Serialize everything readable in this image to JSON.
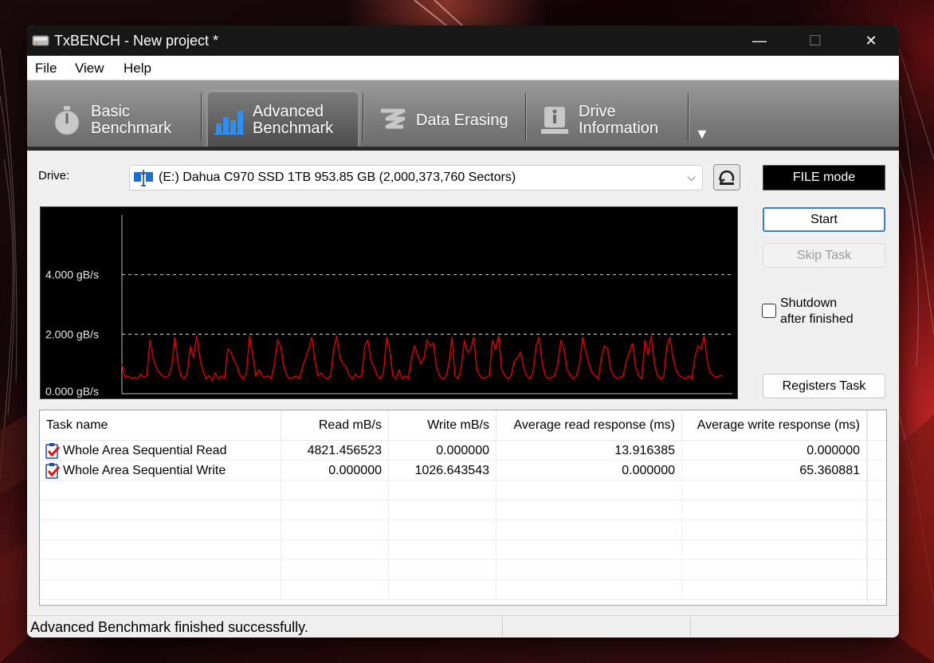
{
  "window": {
    "title": "TxBENCH - New project *",
    "minimize_glyph": "—",
    "maximize_glyph": "☐",
    "close_glyph": "✕"
  },
  "menu": {
    "items": [
      "File",
      "View",
      "Help"
    ]
  },
  "toolbar": {
    "tabs": [
      {
        "line1": "Basic",
        "line2": "Benchmark",
        "icon": "stopwatch-icon"
      },
      {
        "line1": "Advanced",
        "line2": "Benchmark",
        "icon": "bar-chart-icon",
        "active": true
      },
      {
        "line1": "Data Erasing",
        "line2": "",
        "icon": "eraser-icon"
      },
      {
        "line1": "Drive",
        "line2": "Information",
        "icon": "drive-info-icon"
      }
    ],
    "more_glyph": "▼"
  },
  "drive": {
    "label": "Drive:",
    "selected": "(E:) Dahua C970 SSD 1TB  953.85 GB (2,000,373,760 Sectors)",
    "chevron": "⌵",
    "mode": "FILE mode"
  },
  "buttons": {
    "start": "Start",
    "skip": "Skip Task",
    "shutdown_line1": "Shutdown",
    "shutdown_line2": "after finished",
    "registers": "Registers Task"
  },
  "chart_data": {
    "type": "line",
    "ylabel_ticks": [
      "4.000 gB/s",
      "2.000 gB/s",
      "0.000 gB/s"
    ],
    "ylim": [
      0,
      6.0
    ],
    "gridlines": [
      2.0,
      4.0
    ],
    "background": "#000000",
    "line_color": "#e00000",
    "series": [
      {
        "values": [
          1.0,
          0.55,
          0.6,
          0.5,
          0.55,
          0.5,
          0.65,
          0.55,
          0.6,
          1.8,
          1.2,
          0.9,
          0.7,
          0.6,
          0.55,
          0.6,
          0.9,
          1.9,
          1.0,
          0.6,
          0.5,
          0.7,
          1.6,
          1.2,
          1.95,
          1.2,
          0.8,
          0.5,
          0.6,
          0.45,
          0.7,
          0.5,
          0.6,
          0.5,
          1.5,
          1.4,
          1.1,
          0.9,
          0.6,
          0.5,
          0.7,
          1.95,
          1.3,
          0.6,
          0.8,
          0.6,
          0.55,
          0.6,
          0.5,
          1.0,
          1.8,
          1.6,
          0.9,
          0.6,
          0.5,
          0.55,
          0.6,
          0.5,
          0.9,
          1.2,
          1.5,
          1.9,
          1.1,
          0.6,
          0.7,
          0.55,
          0.5,
          0.6,
          1.5,
          1.95,
          1.2,
          1.0,
          0.9,
          0.6,
          0.5,
          0.65,
          0.55,
          0.6,
          1.6,
          1.8,
          1.1,
          0.9,
          0.6,
          0.5,
          0.7,
          1.9,
          1.5,
          0.6,
          0.5,
          0.8,
          0.5,
          0.6,
          0.5,
          1.2,
          1.6,
          1.3,
          1.0,
          1.2,
          1.8,
          1.6,
          1.7,
          0.9,
          0.6,
          0.5,
          0.55,
          1.0,
          1.9,
          0.6,
          0.5,
          0.9,
          1.8,
          1.4,
          1.5,
          1.9,
          0.8,
          0.6,
          0.5,
          0.55,
          0.6,
          1.8,
          1.5,
          1.95,
          0.8,
          0.6,
          0.5,
          0.6,
          1.1,
          1.2,
          1.4,
          0.9,
          0.6,
          0.5,
          0.7,
          1.6,
          1.9,
          1.0,
          0.6,
          0.5,
          0.55,
          0.6,
          1.0,
          1.8,
          1.5,
          0.8,
          0.6,
          0.5,
          0.6,
          1.0,
          1.9,
          1.4,
          1.0,
          0.7,
          0.6,
          0.5,
          1.2,
          1.6,
          1.5,
          0.8,
          0.6,
          0.5,
          0.55,
          0.6,
          1.1,
          1.4,
          1.7,
          0.9,
          0.6,
          0.5,
          1.8,
          1.3,
          1.95,
          1.0,
          0.6,
          0.5,
          0.55,
          1.6,
          1.9,
          1.2,
          0.8,
          0.6,
          0.55,
          0.5,
          0.6,
          0.5,
          1.2,
          1.6,
          1.5,
          1.95,
          1.1,
          0.7,
          0.6,
          0.55,
          0.6,
          0.6
        ]
      }
    ]
  },
  "table": {
    "headers": [
      "Task name",
      "Read mB/s",
      "Write mB/s",
      "Average read response (ms)",
      "Average write response (ms)"
    ],
    "rows": [
      [
        "Whole Area Sequential Read",
        "4821.456523",
        "0.000000",
        "13.916385",
        "0.000000"
      ],
      [
        "Whole Area Sequential Write",
        "0.000000",
        "1026.643543",
        "0.000000",
        "65.360881"
      ]
    ]
  },
  "status": {
    "message": "Advanced Benchmark finished successfully."
  }
}
